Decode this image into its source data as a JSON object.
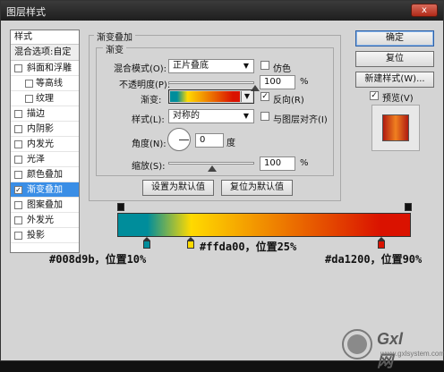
{
  "window": {
    "title": "图层样式",
    "close_glyph": "x"
  },
  "sidebar": {
    "header": "样式",
    "blend_options": "混合选项:自定",
    "items": [
      {
        "label": "斜面和浮雕",
        "checked": false,
        "sub": false,
        "active": false
      },
      {
        "label": "等高线",
        "checked": false,
        "sub": true,
        "active": false
      },
      {
        "label": "纹理",
        "checked": false,
        "sub": true,
        "active": false
      },
      {
        "label": "描边",
        "checked": false,
        "sub": false,
        "active": false
      },
      {
        "label": "内阴影",
        "checked": false,
        "sub": false,
        "active": false
      },
      {
        "label": "内发光",
        "checked": false,
        "sub": false,
        "active": false
      },
      {
        "label": "光泽",
        "checked": false,
        "sub": false,
        "active": false
      },
      {
        "label": "颜色叠加",
        "checked": false,
        "sub": false,
        "active": false
      },
      {
        "label": "渐变叠加",
        "checked": true,
        "sub": false,
        "active": true
      },
      {
        "label": "图案叠加",
        "checked": false,
        "sub": false,
        "active": false
      },
      {
        "label": "外发光",
        "checked": false,
        "sub": false,
        "active": false
      },
      {
        "label": "投影",
        "checked": false,
        "sub": false,
        "active": false
      }
    ]
  },
  "panel": {
    "group_title": "渐变叠加",
    "sub_title": "渐变",
    "blend_mode_label": "混合模式(O):",
    "blend_mode_value": "正片叠底",
    "dither_label": "仿色",
    "opacity_label": "不透明度(P):",
    "opacity_value": "100",
    "opacity_unit": "%",
    "gradient_label": "渐变:",
    "reverse_label": "反向(R)",
    "style_label": "样式(L):",
    "style_value": "对称的",
    "align_label": "与图层对齐(I)",
    "angle_label": "角度(N):",
    "angle_value": "0",
    "angle_unit": "度",
    "scale_label": "缩放(S):",
    "scale_value": "100",
    "scale_unit": "%",
    "set_default_button": "设置为默认值",
    "reset_default_button": "复位为默认值",
    "reverse_checked": true,
    "dither_checked": false,
    "align_checked": false
  },
  "buttons": {
    "ok": "确定",
    "reset": "复位",
    "new_style": "新建样式(W)...",
    "preview_label": "预览(V)",
    "preview_checked": true
  },
  "gradient": {
    "stops": [
      {
        "color": "#008d9b",
        "position": 10
      },
      {
        "color": "#ffda00",
        "position": 25
      },
      {
        "color": "#da1200",
        "position": 90
      }
    ]
  },
  "annotations": {
    "stop1": "#008d9b，位置10%",
    "stop2": "#ffda00，位置25%",
    "stop3": "#da1200，位置90%"
  },
  "watermark": {
    "text": "Gxl 网",
    "sub": "www.gxlsystem.com"
  },
  "icons": {
    "check": "✓",
    "dropdown": "▼"
  }
}
